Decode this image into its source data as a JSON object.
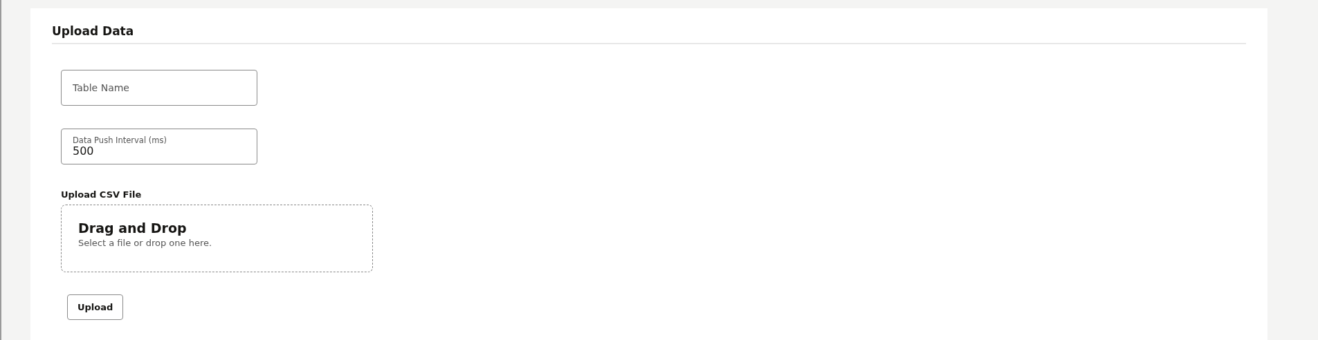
{
  "panel": {
    "title": "Upload Data"
  },
  "fields": [
    {
      "label": "Table Name"
    },
    {
      "label": "Data Push Interval (ms)",
      "value": "500"
    }
  ],
  "file_upload": {
    "label": "Upload CSV File",
    "title": "Drag and Drop",
    "hint": "Select a file or drop one here."
  },
  "buttons": [
    "Upload"
  ]
}
